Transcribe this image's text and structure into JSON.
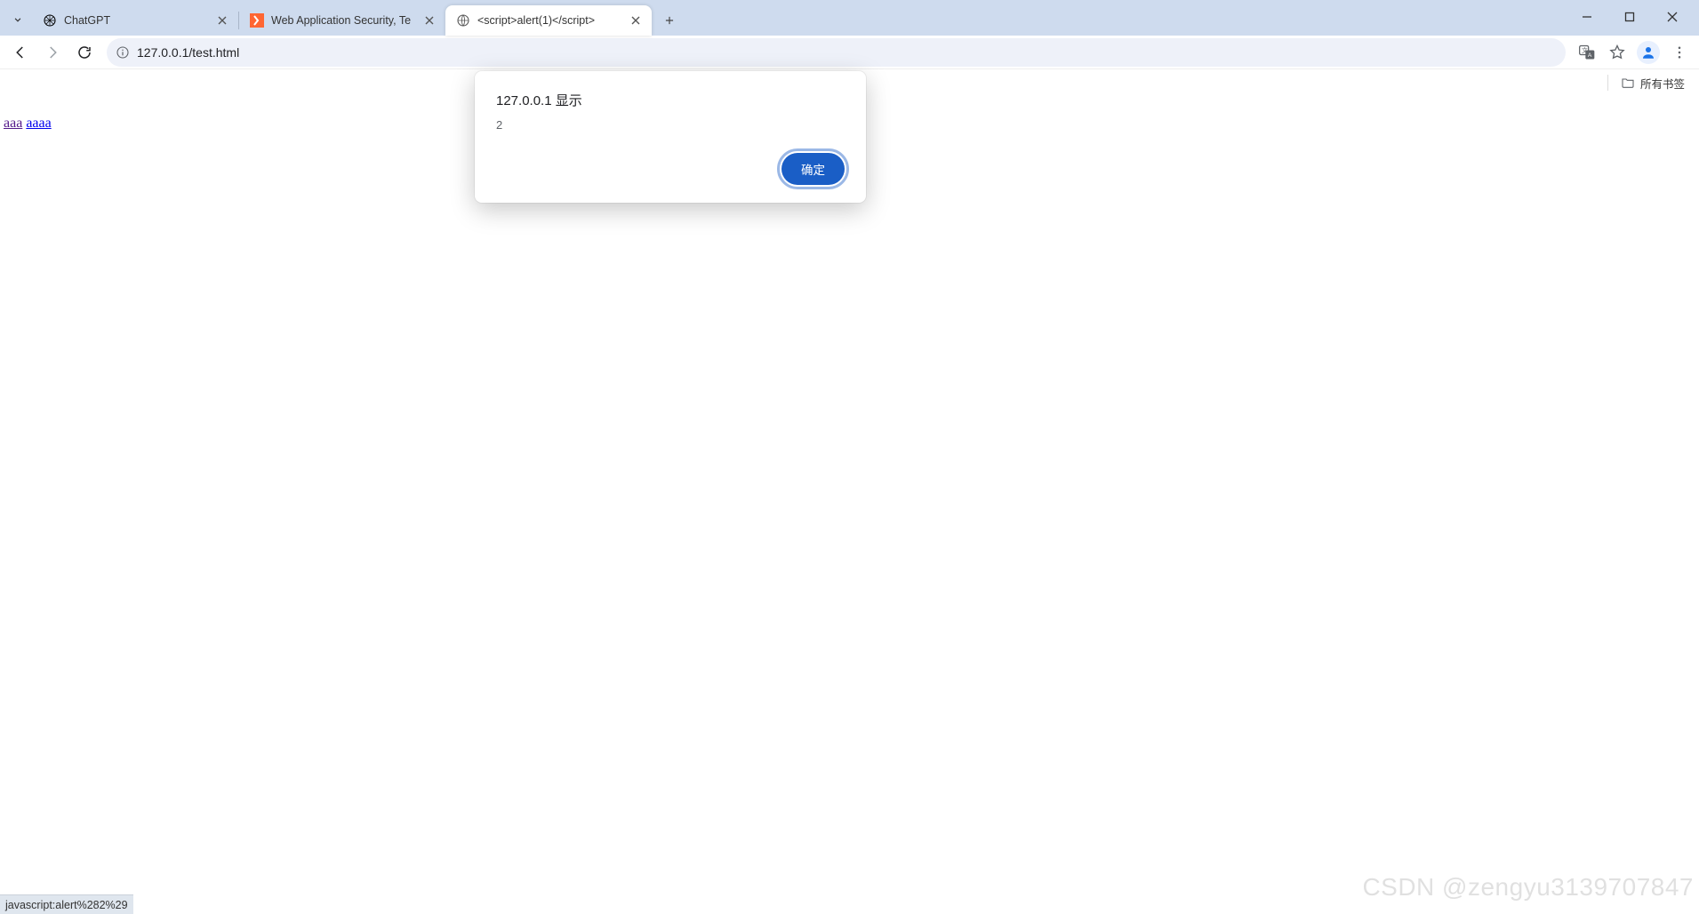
{
  "tabs": [
    {
      "title": "ChatGPT",
      "favicon": "chatgpt",
      "active": false
    },
    {
      "title": "Web Application Security, Te",
      "favicon": "burp",
      "active": false
    },
    {
      "title": "<script>alert(1)</script>",
      "favicon": "globe",
      "active": true
    }
  ],
  "window_controls": {
    "minimize": "—",
    "maximize": "",
    "close": "✕"
  },
  "toolbar": {
    "address": "127.0.0.1/test.html"
  },
  "bookmarks": {
    "all_label": "所有书签"
  },
  "page": {
    "link1": "aaa",
    "link2": "aaaa"
  },
  "alert": {
    "heading": "127.0.0.1 显示",
    "message": "2",
    "ok_label": "确定"
  },
  "statusbar": {
    "text": "javascript:alert%282%29"
  },
  "watermark": "CSDN @zengyu3139707847"
}
